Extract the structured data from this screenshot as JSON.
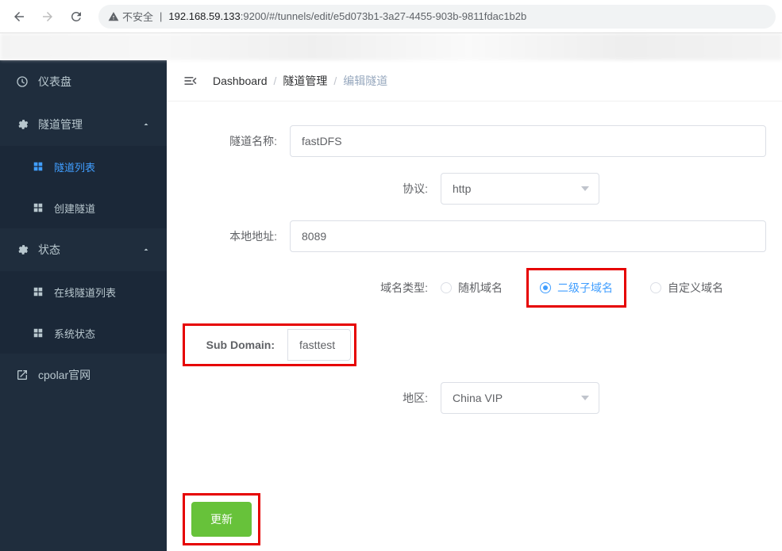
{
  "browser": {
    "insecure_label": "不安全",
    "url_host": "192.168.59.133",
    "url_port": ":9200",
    "url_path": "/#/tunnels/edit/e5d073b1-3a27-4455-903b-9811fdac1b2b"
  },
  "sidebar": {
    "dashboard": "仪表盘",
    "tunnel_manage": "隧道管理",
    "tunnel_list": "隧道列表",
    "tunnel_create": "创建隧道",
    "status": "状态",
    "online_tunnels": "在线隧道列表",
    "system_status": "系统状态",
    "cpolar_site": "cpolar官网"
  },
  "breadcrumb": {
    "dashboard": "Dashboard",
    "tunnel_manage": "隧道管理",
    "edit_tunnel": "编辑隧道"
  },
  "form": {
    "tunnel_name_label": "隧道名称:",
    "tunnel_name_value": "fastDFS",
    "protocol_label": "协议:",
    "protocol_value": "http",
    "local_addr_label": "本地地址:",
    "local_addr_value": "8089",
    "domain_type_label": "域名类型:",
    "domain_random": "随机域名",
    "domain_subdomain": "二级子域名",
    "domain_custom": "自定义域名",
    "subdomain_label": "Sub Domain:",
    "subdomain_value": "fasttest",
    "region_label": "地区:",
    "region_value": "China VIP",
    "submit_label": "更新"
  }
}
